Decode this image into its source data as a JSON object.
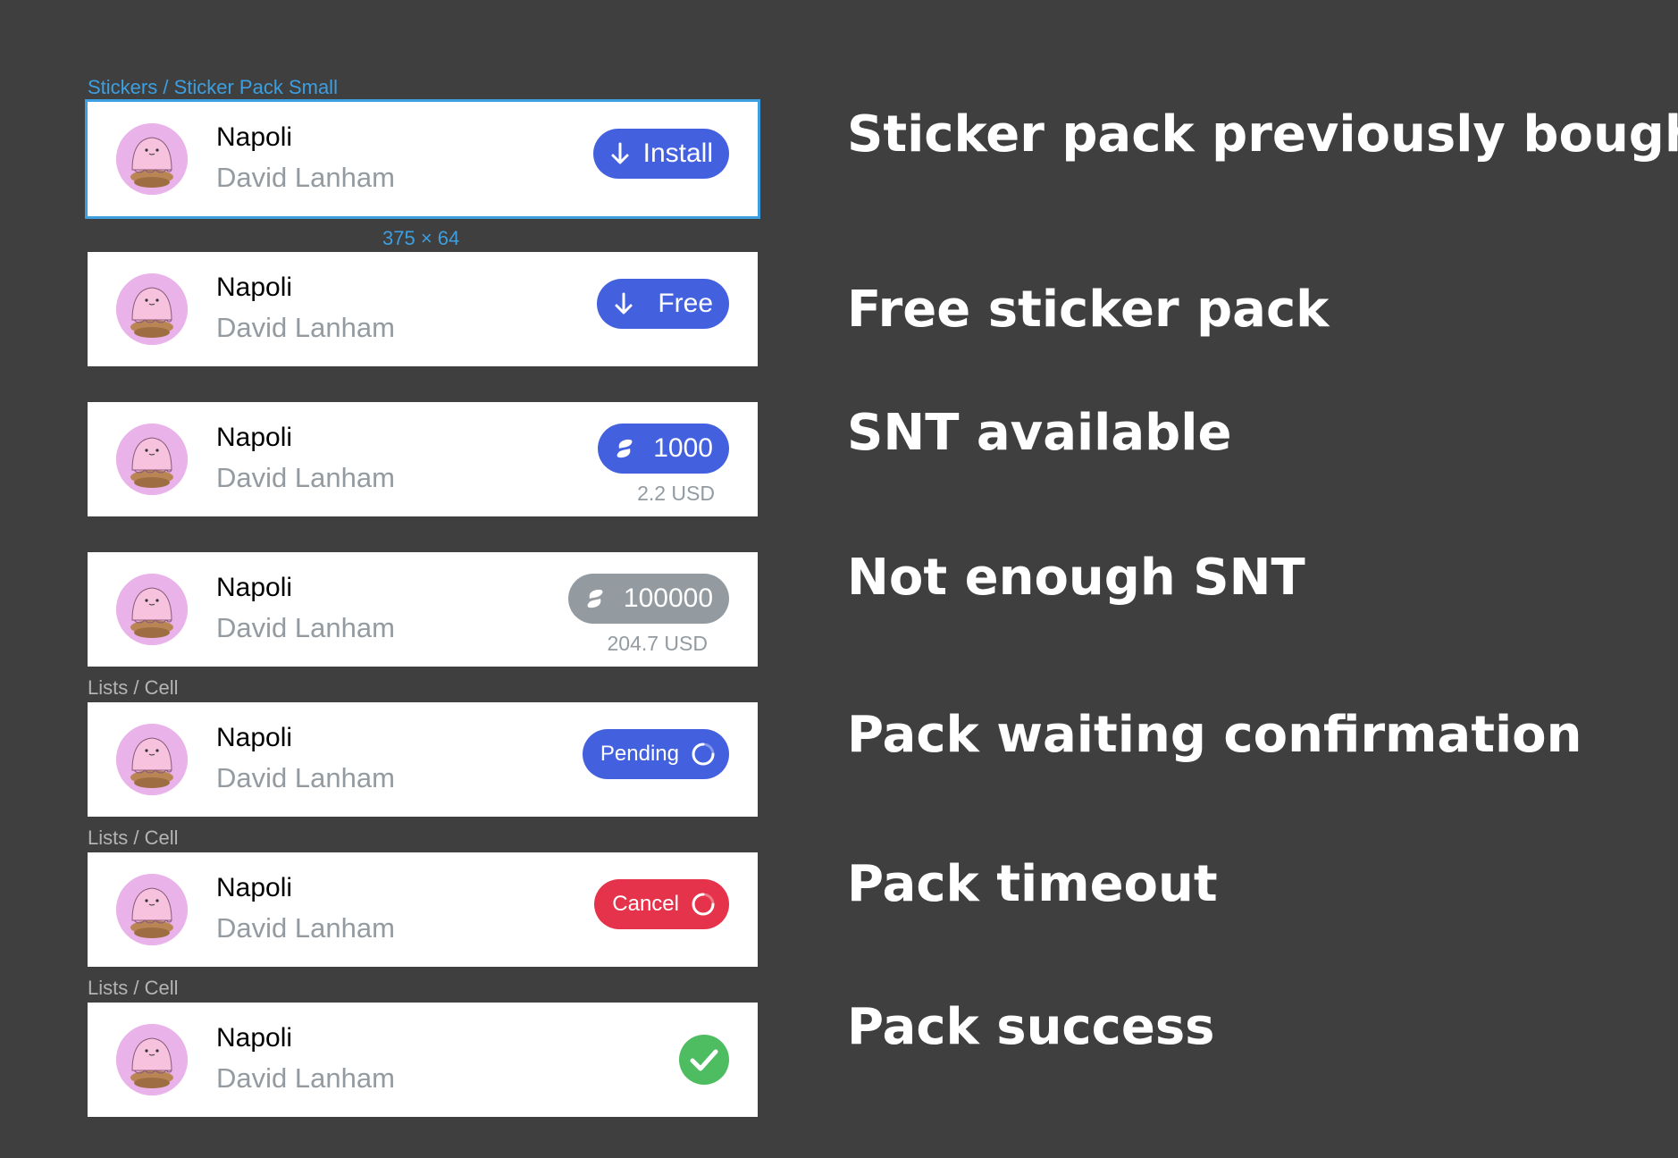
{
  "frame_labels": {
    "first": "Stickers / Sticker Pack Small",
    "cell": "Lists / Cell",
    "dimensions": "375 × 64"
  },
  "colors": {
    "background": "#3f3f3f",
    "cell": "#ffffff",
    "selection": "#3d9fe0",
    "primary": "#4360df",
    "disabled": "#939ba1",
    "danger": "#e5334b",
    "success": "#4ebc60",
    "avatar": "#e9b3ea"
  },
  "rows": [
    {
      "title": "Napoli",
      "author": "David Lanham",
      "action": {
        "type": "install",
        "icon": "arrow-down-icon",
        "label": "Install"
      },
      "description": "Sticker pack previously bought"
    },
    {
      "title": "Napoli",
      "author": "David Lanham",
      "action": {
        "type": "free",
        "icon": "arrow-down-icon",
        "label": "Free"
      },
      "description": "Free sticker pack"
    },
    {
      "title": "Napoli",
      "author": "David Lanham",
      "action": {
        "type": "price",
        "icon": "snt-token-icon",
        "label": "1000",
        "fiat": "2.2 USD"
      },
      "description": "SNT available"
    },
    {
      "title": "Napoli",
      "author": "David Lanham",
      "action": {
        "type": "price-disabled",
        "icon": "snt-token-icon",
        "label": "100000",
        "fiat": "204.7 USD"
      },
      "description": "Not enough SNT"
    },
    {
      "title": "Napoli",
      "author": "David Lanham",
      "action": {
        "type": "pending",
        "icon": "spinner-icon",
        "label": "Pending"
      },
      "description": "Pack waiting confirmation"
    },
    {
      "title": "Napoli",
      "author": "David Lanham",
      "action": {
        "type": "cancel",
        "icon": "spinner-icon",
        "label": "Cancel"
      },
      "description": "Pack timeout"
    },
    {
      "title": "Napoli",
      "author": "David Lanham",
      "action": {
        "type": "success",
        "icon": "checkmark-icon"
      },
      "description": "Pack success"
    }
  ]
}
